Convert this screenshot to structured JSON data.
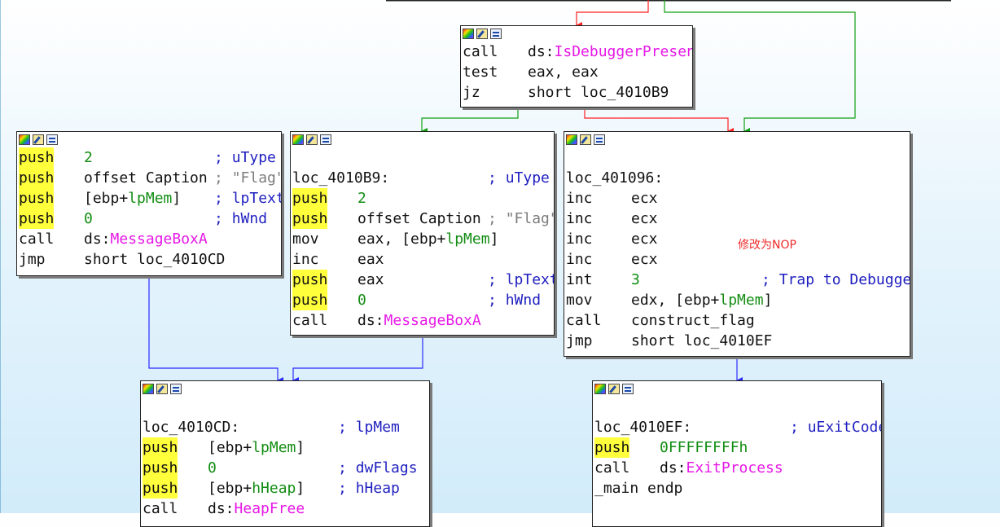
{
  "annotation": {
    "text": "修改为NOP",
    "color": "#ef2a2a"
  },
  "colors": {
    "highlight": "#ffff3c",
    "comment": "#1f1fc0",
    "string": "#7c7c7c",
    "number": "#138d13",
    "import": "#e618e6",
    "edge_true": "#10a010",
    "edge_false": "#ff2020",
    "edge_uncond": "#2a2aff"
  },
  "blocks": [
    {
      "id": "block-debugger-check",
      "lines": [
        {
          "mn": "call",
          "ops": [
            {
              "t": "ds:"
            },
            {
              "t": "IsDebuggerPresent",
              "c": "imp"
            }
          ]
        },
        {
          "mn": "test",
          "ops": [
            {
              "t": "eax, eax"
            }
          ]
        },
        {
          "mn": "jz",
          "ops": [
            {
              "t": "short loc_4010B9"
            }
          ]
        }
      ]
    },
    {
      "id": "block-messagebox-flag",
      "lines": [
        {
          "mn": "push",
          "hl": true,
          "ops": [
            {
              "t": "2",
              "c": "num"
            }
          ],
          "cm": "; uType"
        },
        {
          "mn": "push",
          "hl": true,
          "ops": [
            {
              "t": "offset Caption"
            }
          ],
          "cm": "; \"Flag\"",
          "cmc": "str"
        },
        {
          "mn": "push",
          "hl": true,
          "ops": [
            {
              "t": "[ebp+"
            },
            {
              "t": "lpMem",
              "c": "var"
            },
            {
              "t": "]"
            }
          ],
          "cm": "; lpText"
        },
        {
          "mn": "push",
          "hl": true,
          "ops": [
            {
              "t": "0",
              "c": "num"
            }
          ],
          "cm": "; hWnd"
        },
        {
          "mn": "call",
          "ops": [
            {
              "t": "ds:"
            },
            {
              "t": "MessageBoxA",
              "c": "imp"
            }
          ]
        },
        {
          "mn": "jmp",
          "ops": [
            {
              "t": "short loc_4010CD"
            }
          ]
        }
      ]
    },
    {
      "id": "block-loc-4010b9",
      "lines": [
        {
          "label": "loc_4010B9:",
          "cm": "; uType"
        },
        {
          "mn": "push",
          "hl": true,
          "ops": [
            {
              "t": "2",
              "c": "num"
            }
          ]
        },
        {
          "mn": "push",
          "hl": true,
          "ops": [
            {
              "t": "offset Caption"
            }
          ],
          "cm": "; \"Flag\"",
          "cmc": "str"
        },
        {
          "mn": "mov",
          "ops": [
            {
              "t": "eax, [ebp+"
            },
            {
              "t": "lpMem",
              "c": "var"
            },
            {
              "t": "]"
            }
          ]
        },
        {
          "mn": "inc",
          "ops": [
            {
              "t": "eax"
            }
          ]
        },
        {
          "mn": "push",
          "hl": true,
          "ops": [
            {
              "t": "eax"
            }
          ],
          "cm": "; lpText"
        },
        {
          "mn": "push",
          "hl": true,
          "ops": [
            {
              "t": "0",
              "c": "num"
            }
          ],
          "cm": "; hWnd"
        },
        {
          "mn": "call",
          "ops": [
            {
              "t": "ds:"
            },
            {
              "t": "MessageBoxA",
              "c": "imp"
            }
          ]
        }
      ]
    },
    {
      "id": "block-loc-401096",
      "lines": [
        {
          "label": "loc_401096:"
        },
        {
          "mn": "inc",
          "ops": [
            {
              "t": "ecx"
            }
          ]
        },
        {
          "mn": "inc",
          "ops": [
            {
              "t": "ecx"
            }
          ]
        },
        {
          "mn": "inc",
          "ops": [
            {
              "t": "ecx"
            }
          ]
        },
        {
          "mn": "inc",
          "ops": [
            {
              "t": "ecx"
            }
          ]
        },
        {
          "mn": "int",
          "ops": [
            {
              "t": "3",
              "c": "num"
            }
          ],
          "cm": "; Trap to Debugger"
        },
        {
          "mn": "mov",
          "ops": [
            {
              "t": "edx, [ebp+"
            },
            {
              "t": "lpMem",
              "c": "var"
            },
            {
              "t": "]"
            }
          ]
        },
        {
          "mn": "call",
          "ops": [
            {
              "t": "construct_flag"
            }
          ]
        },
        {
          "mn": "jmp",
          "ops": [
            {
              "t": "short loc_4010EF"
            }
          ]
        }
      ]
    },
    {
      "id": "block-loc-4010cd",
      "lines": [
        {
          "label": "loc_4010CD:",
          "cm": "; lpMem"
        },
        {
          "mn": "push",
          "hl": true,
          "ops": [
            {
              "t": "[ebp+"
            },
            {
              "t": "lpMem",
              "c": "var"
            },
            {
              "t": "]"
            }
          ]
        },
        {
          "mn": "push",
          "hl": true,
          "ops": [
            {
              "t": "0",
              "c": "num"
            }
          ],
          "cm": "; dwFlags"
        },
        {
          "mn": "push",
          "hl": true,
          "ops": [
            {
              "t": "[ebp+"
            },
            {
              "t": "hHeap",
              "c": "var"
            },
            {
              "t": "]"
            }
          ],
          "cm": "; hHeap"
        },
        {
          "mn": "call",
          "ops": [
            {
              "t": "ds:"
            },
            {
              "t": "HeapFree",
              "c": "imp"
            }
          ]
        }
      ]
    },
    {
      "id": "block-loc-4010ef",
      "lines": [
        {
          "label": "loc_4010EF:",
          "cm": "; uExitCode"
        },
        {
          "mn": "push",
          "hl": true,
          "ops": [
            {
              "t": "0FFFFFFFFh",
              "c": "num"
            }
          ]
        },
        {
          "mn": "call",
          "ops": [
            {
              "t": "ds:"
            },
            {
              "t": "ExitProcess",
              "c": "imp"
            }
          ]
        },
        {
          "label": "_main endp"
        }
      ]
    }
  ]
}
